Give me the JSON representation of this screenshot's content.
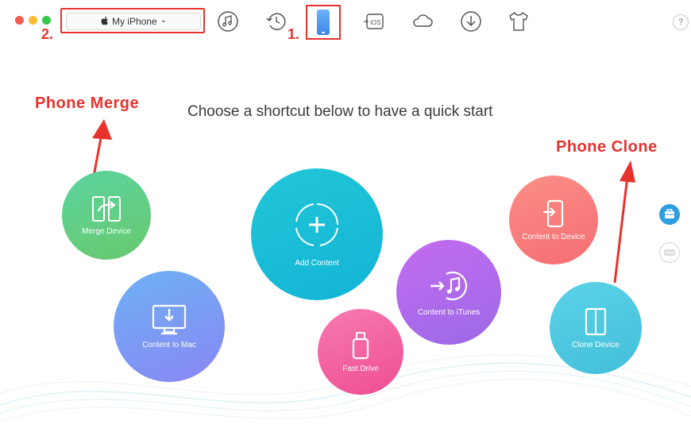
{
  "toolbar": {
    "device_name": "My iPhone",
    "device_chevron": "⌄",
    "help_label": "?",
    "icons": [
      "music-icon",
      "history-icon",
      "phone-icon",
      "ios-transfer-icon",
      "cloud-icon",
      "download-icon",
      "shirt-icon"
    ]
  },
  "annotations": {
    "step_1": "1.",
    "step_2": "2.",
    "phone_merge": "Phone Merge",
    "phone_clone": "Phone Clone"
  },
  "main": {
    "headline": "Choose a shortcut below to have a quick start",
    "shortcuts": {
      "merge_device": "Merge Device",
      "add_content": "Add Content",
      "content_to_mac": "Content to Mac",
      "fast_drive": "Fast Drive",
      "content_to_itunes": "Content to iTunes",
      "content_to_device": "Content to Device",
      "clone_device": "Clone Device"
    }
  },
  "colors": {
    "annotation_red": "#e8322e",
    "merge_green": "#62cf86",
    "add_teal": "#1fbfd6",
    "mac_blue": "#7f9cf6",
    "fast_pink": "#f25ea0",
    "itunes_purple": "#b46ee6",
    "device_coral": "#f97e7a",
    "clone_cyan": "#4fc6e0",
    "side_blue": "#2d9ee0"
  }
}
